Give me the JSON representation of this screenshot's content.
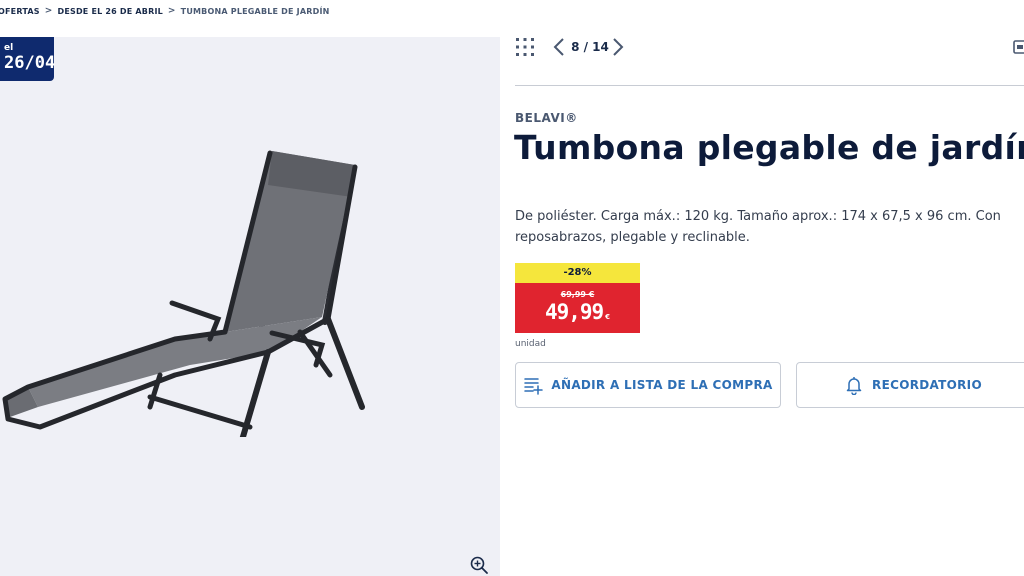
{
  "breadcrumb": {
    "items": [
      "OFERTAS",
      "DESDE EL 26 DE ABRIL",
      "TUMBONA PLEGABLE DE JARDÍN"
    ]
  },
  "badge": {
    "small": "el",
    "date": "26/04",
    "color": "#0f2a6e"
  },
  "gallery": {
    "image_icon": "sun-lounger-image",
    "zoom_icon": "zoom-in-icon"
  },
  "pager": {
    "text": "8 / 14"
  },
  "product": {
    "brand": "BELAVI®",
    "title": "Tumbona plegable de jardín",
    "description": "De poliéster. Carga máx.: 120 kg. Tamaño aprox.: 174 x 67,5 x 96 cm. Con reposabrazos, plegable y reclinable."
  },
  "price": {
    "discount": "-28%",
    "old": "69,99 €",
    "new": "49,99",
    "currency": "€",
    "unit": "unidad",
    "discount_color": "#f5e63c",
    "price_color": "#e0242f"
  },
  "actions": {
    "shopping_list": "AÑADIR A LISTA DE LA COMPRA",
    "reminder": "RECORDATORIO",
    "accent_color": "#2e6fb5"
  }
}
